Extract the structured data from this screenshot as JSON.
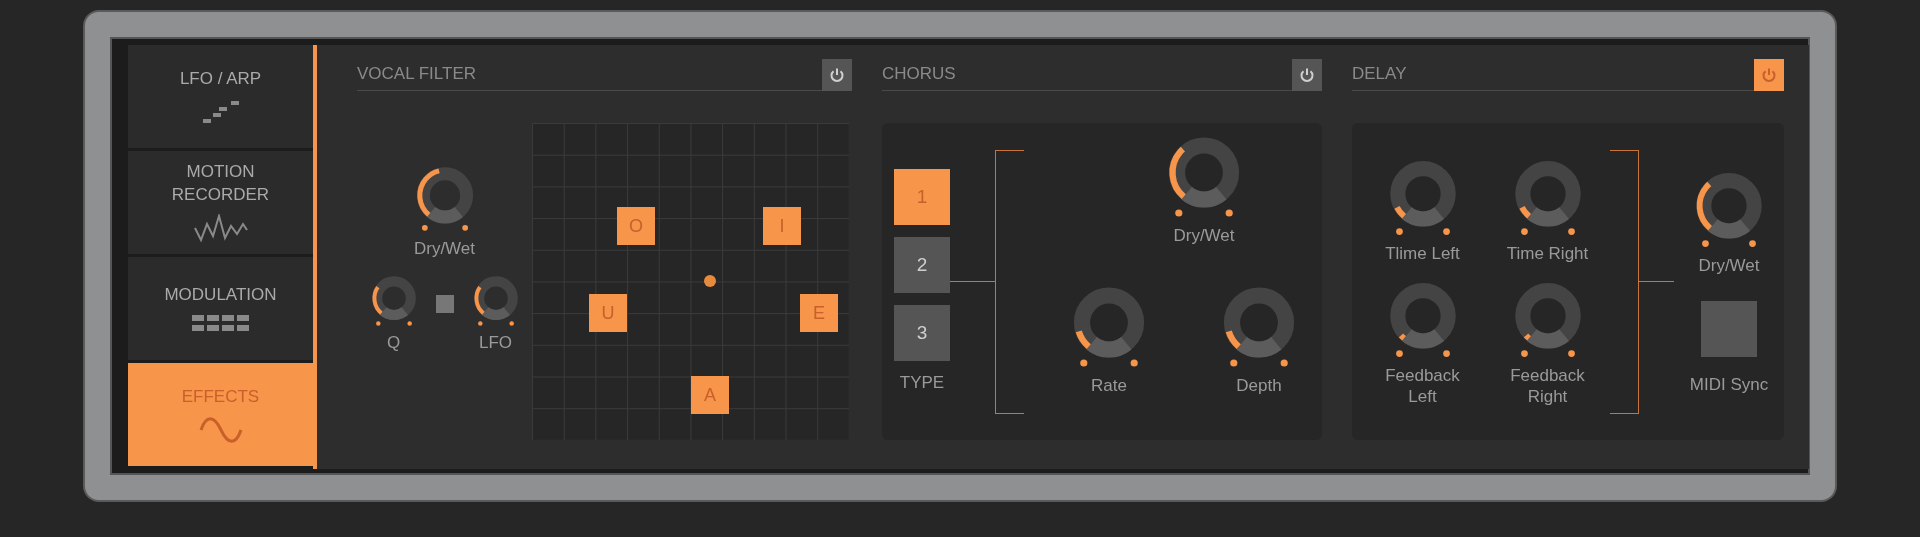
{
  "sidebar": {
    "items": [
      {
        "label": "LFO / ARP",
        "selected": false
      },
      {
        "label": "MOTION RECORDER",
        "selected": false
      },
      {
        "label": "MODULATION",
        "selected": false
      },
      {
        "label": "EFFECTS",
        "selected": true
      }
    ]
  },
  "vocal_filter": {
    "title": "VOCAL FILTER",
    "on": false,
    "knobs": [
      {
        "label": "Dry/Wet",
        "level": 0.45
      },
      {
        "label": "Q",
        "level": 0.3
      },
      {
        "label": "LFO",
        "level": 0.3
      }
    ],
    "lfo_link": {
      "on": false
    },
    "vowels": [
      "O",
      "I",
      "U",
      "E",
      "A"
    ]
  },
  "chorus": {
    "title": "CHORUS",
    "on": false,
    "types": [
      {
        "label": "1",
        "selected": true
      },
      {
        "label": "2",
        "selected": false
      },
      {
        "label": "3",
        "selected": false
      }
    ],
    "type_label": "TYPE",
    "knobs": [
      {
        "label": "Dry/Wet",
        "level": 0.35
      },
      {
        "label": "Rate",
        "level": 0.12
      },
      {
        "label": "Depth",
        "level": 0.12
      }
    ]
  },
  "delay": {
    "title": "DELAY",
    "on": true,
    "knobs": [
      {
        "label": "Tlime Left",
        "level": 0.08
      },
      {
        "label": "Time Right",
        "level": 0.08
      },
      {
        "label": "Feedback Left",
        "level": 0.03
      },
      {
        "label": "Feedback Right",
        "level": 0.03
      },
      {
        "label": "Dry/Wet",
        "level": 0.35
      }
    ],
    "midi_sync": {
      "label": "MIDI Sync",
      "on": false
    }
  }
}
